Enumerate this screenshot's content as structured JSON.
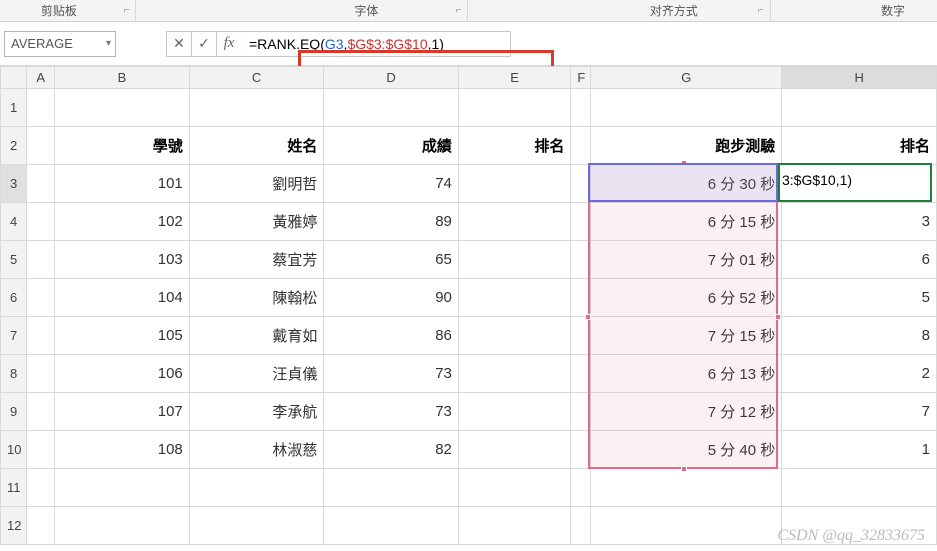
{
  "ribbon": {
    "clip_label": "剪贴板",
    "font_label": "字体",
    "align_label": "对齐方式",
    "number_label": "数字",
    "launcher_glyph": "⌐"
  },
  "namebox": {
    "value": "AVERAGE"
  },
  "formula_buttons": {
    "cancel": "✕",
    "enter": "✓",
    "fx": "fx"
  },
  "formula": {
    "pre": "=RANK.EQ(",
    "arg1": "G3",
    "sep1": ",",
    "arg2": "$G$3:$G$10",
    "sep2": ",",
    "arg3": "1",
    "post": ")"
  },
  "active_cell_text": "3:$G$10,1)",
  "columns": [
    "",
    "A",
    "B",
    "C",
    "D",
    "E",
    "F",
    "G",
    "H"
  ],
  "headers": {
    "B": "學號",
    "C": "姓名",
    "D": "成績",
    "E": "排名",
    "G": "跑步測驗",
    "H": "排名"
  },
  "rows": [
    {
      "r": 1
    },
    {
      "r": 2
    },
    {
      "r": 3,
      "B": "101",
      "C": "劉明哲",
      "D": "74",
      "G": "6 分 30 秒",
      "H": ""
    },
    {
      "r": 4,
      "B": "102",
      "C": "黃雅婷",
      "D": "89",
      "G": "6 分 15 秒",
      "H": "3"
    },
    {
      "r": 5,
      "B": "103",
      "C": "蔡宜芳",
      "D": "65",
      "G": "7 分 01 秒",
      "H": "6"
    },
    {
      "r": 6,
      "B": "104",
      "C": "陳翰松",
      "D": "90",
      "G": "6 分 52 秒",
      "H": "5"
    },
    {
      "r": 7,
      "B": "105",
      "C": "戴育如",
      "D": "86",
      "G": "7 分 15 秒",
      "H": "8"
    },
    {
      "r": 8,
      "B": "106",
      "C": "汪貞儀",
      "D": "73",
      "G": "6 分 13 秒",
      "H": "2"
    },
    {
      "r": 9,
      "B": "107",
      "C": "李承航",
      "D": "73",
      "G": "7 分 12 秒",
      "H": "7"
    },
    {
      "r": 10,
      "B": "108",
      "C": "林淑慈",
      "D": "82",
      "G": "5 分 40 秒",
      "H": "1"
    },
    {
      "r": 11
    },
    {
      "r": 12
    }
  ],
  "watermark": "CSDN @qq_32833675",
  "chart_data": {
    "type": "table",
    "title": "跑步測驗排名 RANK.EQ 示例",
    "columns": [
      "學號",
      "姓名",
      "成績",
      "排名",
      "跑步測驗",
      "排名"
    ],
    "records": [
      {
        "學號": 101,
        "姓名": "劉明哲",
        "成績": 74,
        "跑步測驗": "6 分 30 秒",
        "排名_跑步": null
      },
      {
        "學號": 102,
        "姓名": "黃雅婷",
        "成績": 89,
        "跑步測驗": "6 分 15 秒",
        "排名_跑步": 3
      },
      {
        "學號": 103,
        "姓名": "蔡宜芳",
        "成績": 65,
        "跑步測驗": "7 分 01 秒",
        "排名_跑步": 6
      },
      {
        "學號": 104,
        "姓名": "陳翰松",
        "成績": 90,
        "跑步測驗": "6 分 52 秒",
        "排名_跑步": 5
      },
      {
        "學號": 105,
        "姓名": "戴育如",
        "成績": 86,
        "跑步測驗": "7 分 15 秒",
        "排名_跑步": 8
      },
      {
        "學號": 106,
        "姓名": "汪貞儀",
        "成績": 73,
        "跑步測驗": "6 分 13 秒",
        "排名_跑步": 2
      },
      {
        "學號": 107,
        "姓名": "李承航",
        "成績": 73,
        "跑步測驗": "7 分 12 秒",
        "排名_跑步": 7
      },
      {
        "學號": 108,
        "姓名": "林淑慈",
        "成績": 82,
        "跑步測驗": "5 分 40 秒",
        "排名_跑步": 1
      }
    ],
    "formula": "=RANK.EQ(G3,$G$3:$G$10,1)"
  }
}
